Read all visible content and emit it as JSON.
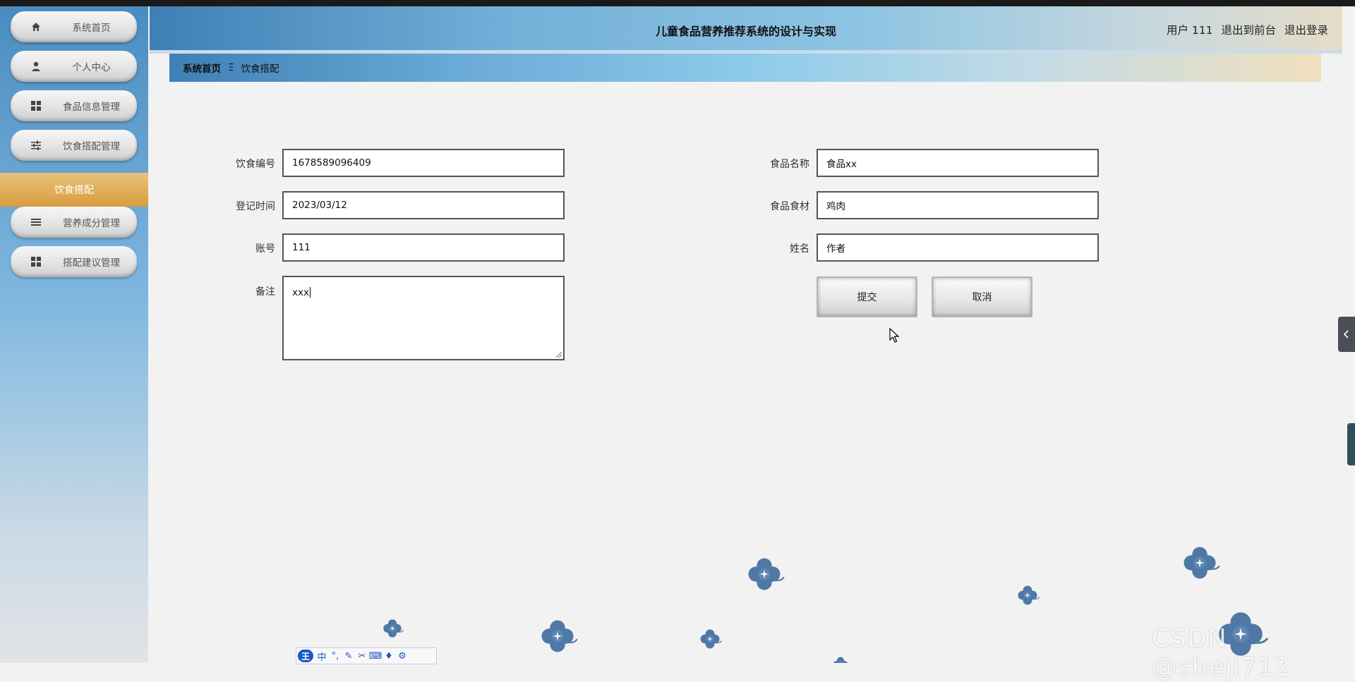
{
  "header": {
    "title": "儿童食品营养推荐系统的设计与实现",
    "user": "用户 111",
    "back_to_front": "退出到前台",
    "logout": "退出登录"
  },
  "sidebar": {
    "items": [
      {
        "label": "系统首页",
        "icon": "home-icon"
      },
      {
        "label": "个人中心",
        "icon": "user-icon"
      },
      {
        "label": "食品信息管理",
        "icon": "grid-icon"
      },
      {
        "label": "饮食搭配管理",
        "icon": "sliders-icon"
      },
      {
        "label": "营养成分管理",
        "icon": "list-icon"
      },
      {
        "label": "搭配建议管理",
        "icon": "grid-icon"
      }
    ],
    "active_sub": "饮食搭配"
  },
  "breadcrumb": {
    "home": "系统首页",
    "separator": "Ξ",
    "current": "饮食搭配"
  },
  "form": {
    "diet_no_label": "饮食编号",
    "diet_no": "1678589096409",
    "register_time_label": "登记时间",
    "register_time": "2023/03/12",
    "account_label": "账号",
    "account": "111",
    "remark_label": "备注",
    "remark": "xxx",
    "food_name_label": "食品名称",
    "food_name": "食品xx",
    "ingredient_label": "食品食材",
    "ingredient": "鸡肉",
    "name_label": "姓名",
    "name": "作者",
    "submit": "提交",
    "cancel": "取消"
  },
  "ime": {
    "logo": "王",
    "mode": "中"
  },
  "watermark": "CSDN @sheji712",
  "colors": {
    "sidebar_active": "#d89c3f",
    "flower": "#4f78a6"
  }
}
